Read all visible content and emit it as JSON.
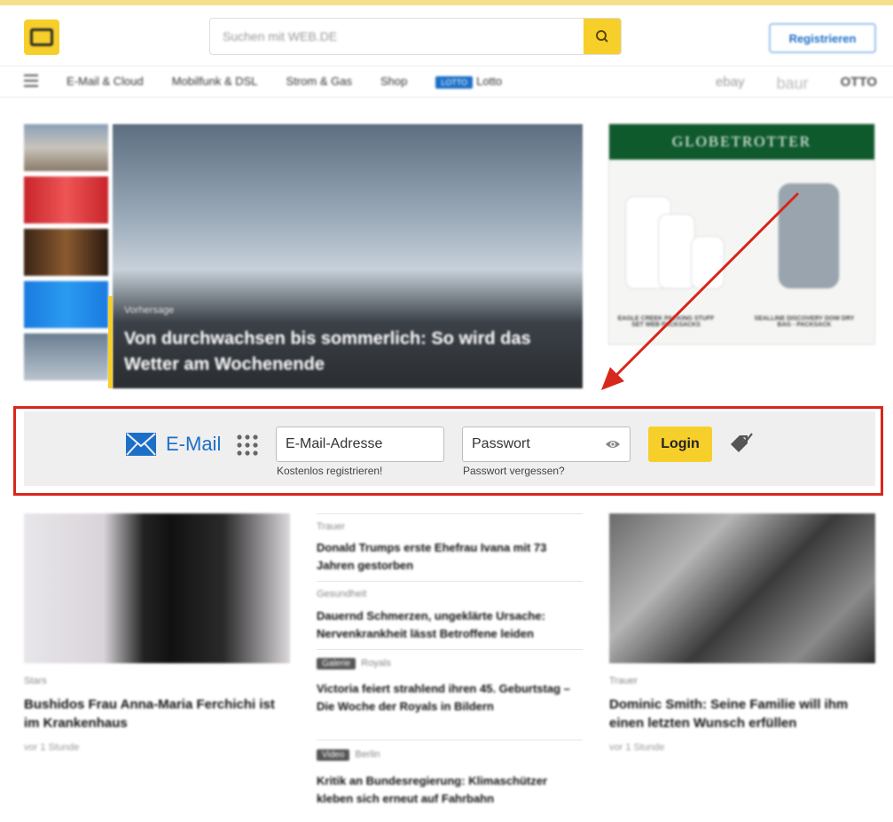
{
  "header": {
    "search_placeholder": "Suchen mit WEB.DE",
    "register_label": "Registrieren"
  },
  "nav": {
    "items": [
      "E-Mail & Cloud",
      "Mobilfunk & DSL",
      "Strom & Gas",
      "Shop"
    ],
    "lotto_badge": "LOTTO",
    "lotto_label": "Lotto",
    "partners": [
      "ebay",
      "baur",
      "OTTO"
    ]
  },
  "hero": {
    "kicker": "Vorhersage",
    "title": "Von durchwachsen bis sommerlich: So wird das Wetter am Wochenende"
  },
  "ad": {
    "brand": "GLOBETROTTER",
    "caption_left": "EAGLE CREEK PACKING STUFF SET WEB PACKSACKS",
    "caption_right": "SEALLINE DISCOVERY DOW DRY BAG - PACKSACK"
  },
  "login": {
    "mail_label": "E-Mail",
    "email_placeholder": "E-Mail-Adresse",
    "password_placeholder": "Passwort",
    "login_label": "Login",
    "register_link": "Kostenlos registrieren!",
    "forgot_link": "Passwort vergessen?"
  },
  "news_left": {
    "kicker": "Stars",
    "title": "Bushidos Frau Anna-Maria Ferchichi ist im Krankenhaus",
    "time": "vor 1 Stunde"
  },
  "news_mid": [
    {
      "tag": "",
      "kicker": "Trauer",
      "title": "Donald Trumps erste Ehefrau Ivana mit 73 Jahren gestorben"
    },
    {
      "tag": "",
      "kicker": "Gesundheit",
      "title": "Dauernd Schmerzen, ungeklärte Ursache: Nervenkrankheit lässt Betroffene leiden"
    },
    {
      "tag": "Galerie",
      "kicker": "Royals",
      "title": "Victoria feiert strahlend ihren 45. Geburtstag – Die Woche der Royals in Bildern"
    },
    {
      "tag": "Video",
      "kicker": "Berlin",
      "title": "Kritik an Bundesregierung: Klimaschützer kleben sich erneut auf Fahrbahn"
    }
  ],
  "news_right": {
    "kicker": "Trauer",
    "title": "Dominic Smith: Seine Familie will ihm einen letzten Wunsch erfüllen",
    "time": "vor 1 Stunde"
  },
  "colors": {
    "brand_yellow": "#f7cf2a",
    "link_blue": "#1c6fc8",
    "highlight_red": "#d8271c"
  }
}
